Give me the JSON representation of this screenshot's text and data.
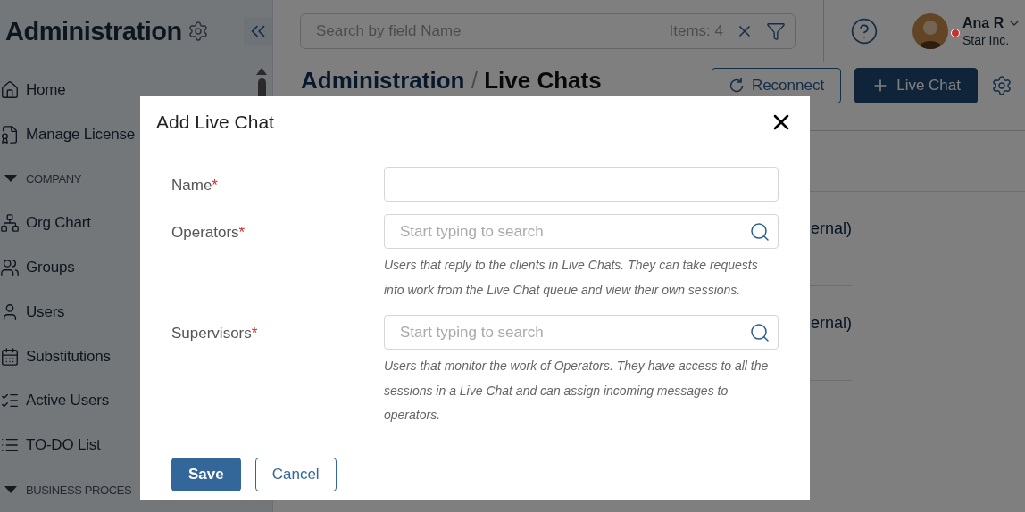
{
  "sidebar": {
    "title": "Administration",
    "items": [
      {
        "kind": "link",
        "label": "Home"
      },
      {
        "kind": "link",
        "label": "Manage License"
      },
      {
        "kind": "section",
        "label": "COMPANY",
        "expanded": true
      },
      {
        "kind": "link",
        "label": "Org Chart"
      },
      {
        "kind": "link",
        "label": "Groups"
      },
      {
        "kind": "link",
        "label": "Users"
      },
      {
        "kind": "link",
        "label": "Substitutions"
      },
      {
        "kind": "link",
        "label": "Active Users"
      },
      {
        "kind": "link",
        "label": "TO-DO List"
      },
      {
        "kind": "section",
        "label": "BUSINESS PROCES",
        "expanded": true
      }
    ]
  },
  "search": {
    "placeholder": "Search by field Name",
    "count": "Items: 4"
  },
  "user": {
    "name": "Ana R",
    "company": "Star Inc."
  },
  "breadcrumb": {
    "parent": "Administration",
    "separator": "/",
    "current": "Live Chats"
  },
  "actions": [
    {
      "kind": "outline",
      "label": "Reconnect"
    },
    {
      "kind": "primary",
      "label": "Live Chat"
    }
  ],
  "rows": [
    {
      "column_3": "ernal)"
    },
    {
      "column_3": "ernal)"
    }
  ],
  "dialog": {
    "title": "Add Live Chat",
    "fields": [
      {
        "kind": "text",
        "label": "Name",
        "required_mark": "*"
      },
      {
        "kind": "search",
        "label": "Operators",
        "required_mark": "*",
        "placeholder": "Start typing to search",
        "hint": "Users that reply to the clients in Live Chats. They can take requests into work from the Live Chat queue and view their own sessions."
      },
      {
        "kind": "search",
        "label": "Supervisors",
        "required_mark": "*",
        "placeholder": "Start typing to search",
        "hint": "Users that monitor the work of Operators. They have access to all the sessions in a Live Chat and can assign incoming messages to operators."
      }
    ],
    "buttons": [
      {
        "kind": "primary",
        "label": "Save"
      },
      {
        "kind": "secondary",
        "label": "Cancel"
      }
    ]
  }
}
